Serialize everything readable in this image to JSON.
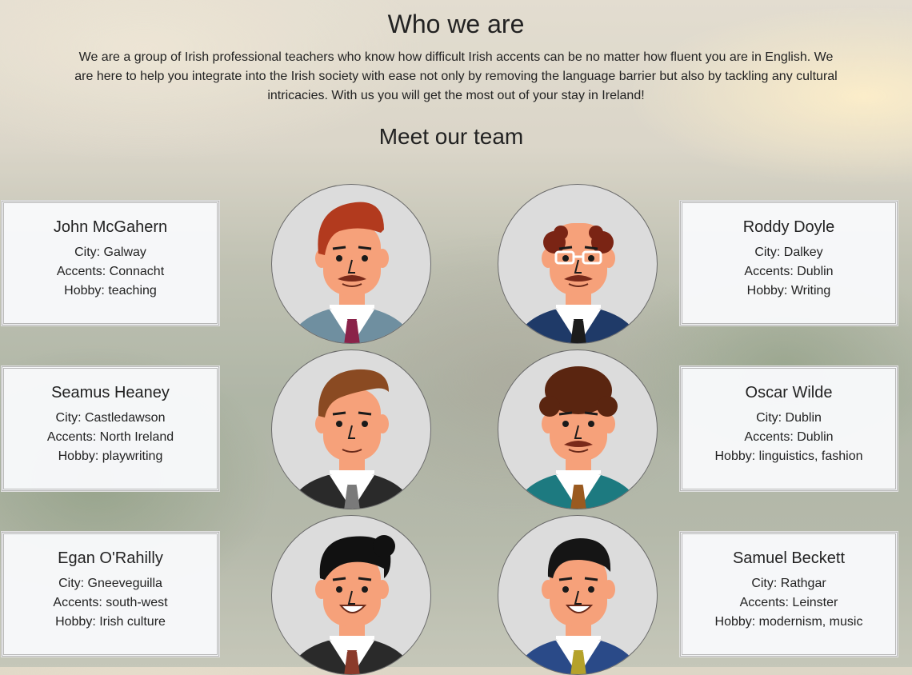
{
  "heading": "Who we are",
  "intro": "We are a group of Irish professional teachers who know how difficult Irish accents can be no matter how fluent you are in English. We are here to help you integrate into the Irish society with ease not only by removing the language barrier but also by tackling any cultural intricacies. With us you will get the most out of your stay in Ireland!",
  "team_heading": "Meet our team",
  "team": [
    {
      "name": "John McGahern",
      "city": "City: Galway",
      "accents": "Accents: Connacht",
      "hobby": "Hobby: teaching",
      "avatar": "man-red-hair-mustache-avatar",
      "hair": "#b23a1e",
      "jacket": "#6f8fa0",
      "tie": "#8a2249"
    },
    {
      "name": "Roddy Doyle",
      "city": "City: Dalkey",
      "accents": "Accents: Dublin",
      "hobby": "Hobby: Writing",
      "avatar": "bald-man-glasses-avatar",
      "hair": "#7a2414",
      "jacket": "#1f3a68",
      "tie": "#1c1c1c"
    },
    {
      "name": "Seamus Heaney",
      "city": "City: Castledawson",
      "accents": "Accents: North Ireland",
      "hobby": "Hobby: playwriting",
      "avatar": "man-brown-hair-avatar",
      "hair": "#8a4a22",
      "jacket": "#2a2a2a",
      "tie": "#7a7a7a"
    },
    {
      "name": "Oscar Wilde",
      "city": "City: Dublin",
      "accents": "Accents: Dublin",
      "hobby": "Hobby: linguistics, fashion",
      "avatar": "man-curly-hair-mustache-avatar",
      "hair": "#5a2510",
      "jacket": "#1d7a80",
      "tie": "#9a5a20"
    },
    {
      "name": "Egan O'Rahilly",
      "city": "City: Gneeveguilla",
      "accents": "Accents: south-west",
      "hobby": "Hobby: Irish culture",
      "avatar": "man-black-quiff-avatar",
      "hair": "#111111",
      "jacket": "#2a2a2a",
      "tie": "#8a3a2a"
    },
    {
      "name": "Samuel Beckett",
      "city": "City: Rathgar",
      "accents": "Accents: Leinster",
      "hobby": "Hobby: modernism, music",
      "avatar": "man-black-hair-avatar",
      "hair": "#151515",
      "jacket": "#2a4a88",
      "tie": "#b5a22a"
    }
  ]
}
